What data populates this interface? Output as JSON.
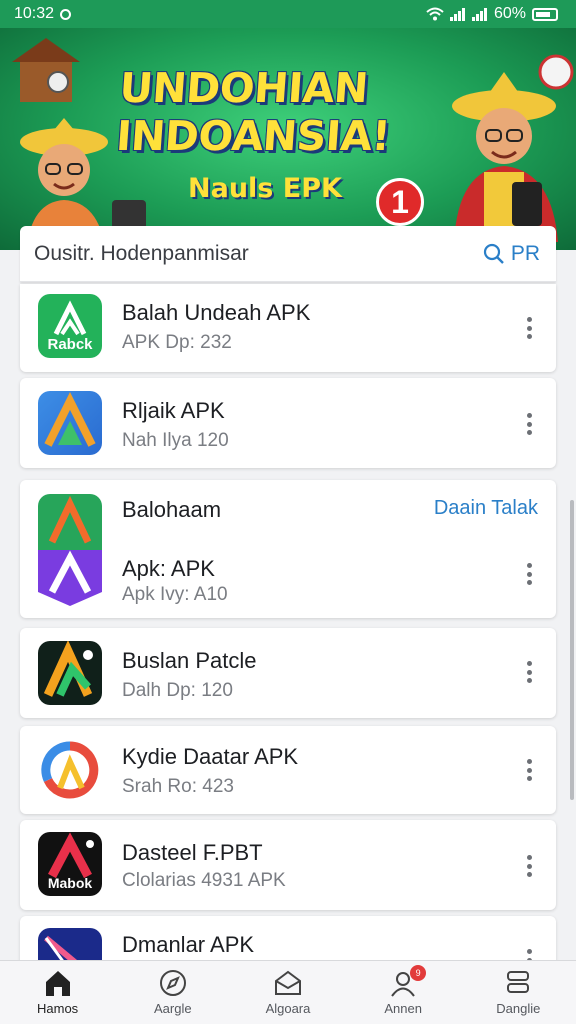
{
  "status": {
    "time": "10:32",
    "battery": "60%"
  },
  "banner": {
    "title": "UNDOHIAN INDOANSIA!",
    "subtitle": "Nauls EPK",
    "badge": "1"
  },
  "search": {
    "text": "Ousitr. Hodenpanmisar",
    "action": "PR"
  },
  "apps": [
    {
      "title": "Balah Undeah APK",
      "subtitle": "APK Dp: 232",
      "icon_text": "Rabck"
    },
    {
      "title": "Rljaik APK",
      "subtitle": "Nah Ilya 120"
    },
    {
      "title": "Apk: APK",
      "subtitle": "Apk Ivy: A10",
      "header": "Balohaam",
      "header_link": "Daain Talak"
    },
    {
      "title": "Buslan Patcle",
      "subtitle": "Dalh Dp: 120"
    },
    {
      "title": "Kydie Daatar APK",
      "subtitle": "Srah Ro: 423"
    },
    {
      "title": "Dasteel F.PBT",
      "subtitle": "Clolarias 4931 APK",
      "icon_text": "Mabok"
    },
    {
      "title": "Dmanlar APK",
      "subtitle": ""
    }
  ],
  "nav": [
    {
      "label": "Hamos",
      "icon": "home-icon"
    },
    {
      "label": "Aargle",
      "icon": "compass-icon"
    },
    {
      "label": "Algoara",
      "icon": "inbox-icon"
    },
    {
      "label": "Annen",
      "icon": "user-icon",
      "badge": "9"
    },
    {
      "label": "Danglie",
      "icon": "stack-icon"
    }
  ],
  "colors": {
    "accent": "#2a7fc8",
    "banner_green": "#1e9a58",
    "title_yellow": "#ffe13a"
  }
}
